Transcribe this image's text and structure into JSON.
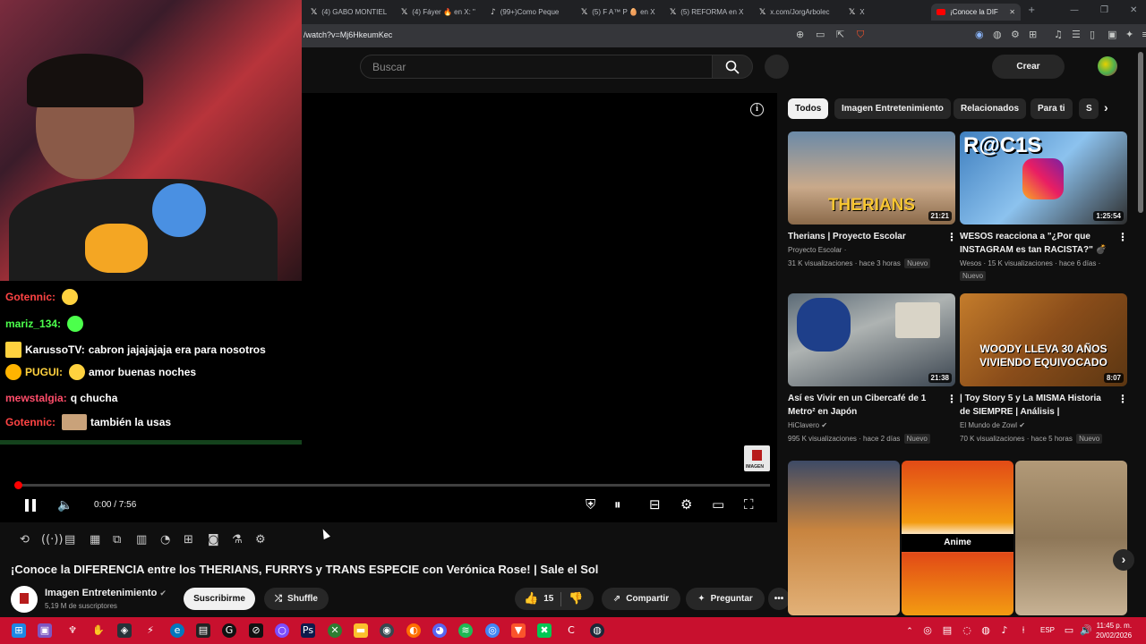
{
  "browser": {
    "tabs": [
      {
        "icon": "x-icon",
        "label": "(4) GABO MONTIEL"
      },
      {
        "icon": "x-icon",
        "label": "(4) Fáyer 🔥 en X: \""
      },
      {
        "icon": "tiktok-icon",
        "label": "(99+)Como Peque"
      },
      {
        "icon": "x-icon",
        "label": "(5) F A™ P 🥚 en X"
      },
      {
        "icon": "x-icon",
        "label": "(5) REFORMA en X"
      },
      {
        "icon": "x-icon",
        "label": "x.com/JorgArbolec"
      },
      {
        "icon": "x-icon",
        "label": "X"
      },
      {
        "icon": "youtube-icon",
        "label": "¡Conoce la DIF",
        "active": true
      }
    ],
    "url": "/watch?v=Mj6HkeumKec"
  },
  "header": {
    "search_placeholder": "Buscar",
    "create_label": "Crear"
  },
  "stream_chat": [
    {
      "user": "Gotennic:",
      "color": "red",
      "message": "",
      "emoji": true
    },
    {
      "user": "mariz_134:",
      "color": "green",
      "message": "",
      "emoji": true
    },
    {
      "user": "KarussoTV:",
      "color": "white",
      "message": "cabron jajajajaja era para nosotros"
    },
    {
      "user": "PUGUI:",
      "color": "white",
      "message": "amor buenas noches"
    },
    {
      "user": "mewstalgia:",
      "color": "red",
      "message": "q chucha"
    },
    {
      "user": "Gotennic:",
      "color": "red",
      "message": "también la usas"
    }
  ],
  "player": {
    "time": "0:00 / 7:56",
    "progress": 0.0,
    "watermark": "IMAGEN"
  },
  "video": {
    "title": "¡Conoce la DIFERENCIA entre los THERIANS, FURRYS y TRANS ESPECIE con Verónica Rose! | Sale el Sol",
    "channel": "Imagen Entretenimiento",
    "subscribers": "5,19 M de suscriptores",
    "subscribe_label": "Suscribirme",
    "shuffle_label": "Shuffle",
    "likes": "15",
    "share_label": "Compartir",
    "ask_label": "Preguntar"
  },
  "chips": [
    "Todos",
    "Imagen Entretenimiento",
    "Relacionados",
    "Para ti",
    "S"
  ],
  "recommendations": [
    {
      "title": "Therians | Proyecto Escolar",
      "channel": "Proyecto Escolar ·",
      "meta": "31 K visualizaciones · hace 3 horas",
      "badge": "Nuevo",
      "duration": "21:21",
      "thumb_text": "THERIANS"
    },
    {
      "title": "WESOS reacciona a \"¿Por que INSTAGRAM es tan RACISTA?\" 💣 ...",
      "channel": "",
      "meta": "Wesos · 15 K visualizaciones · hace 6 días ·",
      "badge": "Nuevo",
      "duration": "1:25:54",
      "thumb_text": "R@C1S"
    },
    {
      "title": "Así es Vivir en un Cibercafé de 1 Metro² en Japón",
      "channel": "HiClavero ✔",
      "meta": "995 K visualizaciones · hace 2 días",
      "badge": "Nuevo",
      "duration": "21:38",
      "thumb_text": ""
    },
    {
      "title": "| Toy Story 5 y La MISMA Historia de SIEMPRE | Análisis |",
      "channel": "El Mundo de Zowl ✔",
      "meta": "70 K visualizaciones · hace 5 horas",
      "badge": "Nuevo",
      "duration": "8:07",
      "thumb_text": "WOODY LLEVA 30 AÑOS VIVIENDO EQUIVOCADO"
    }
  ],
  "shorts": [
    {
      "label": ""
    },
    {
      "label": "Anime"
    },
    {
      "label": ""
    }
  ],
  "taskbar": {
    "lang": "ESP",
    "time": "11:45 p. m.",
    "date": "20/02/2026"
  },
  "colors": {
    "youtube_red": "#ff0000",
    "taskbar": "#c8102e",
    "background": "#0f0f0f"
  }
}
